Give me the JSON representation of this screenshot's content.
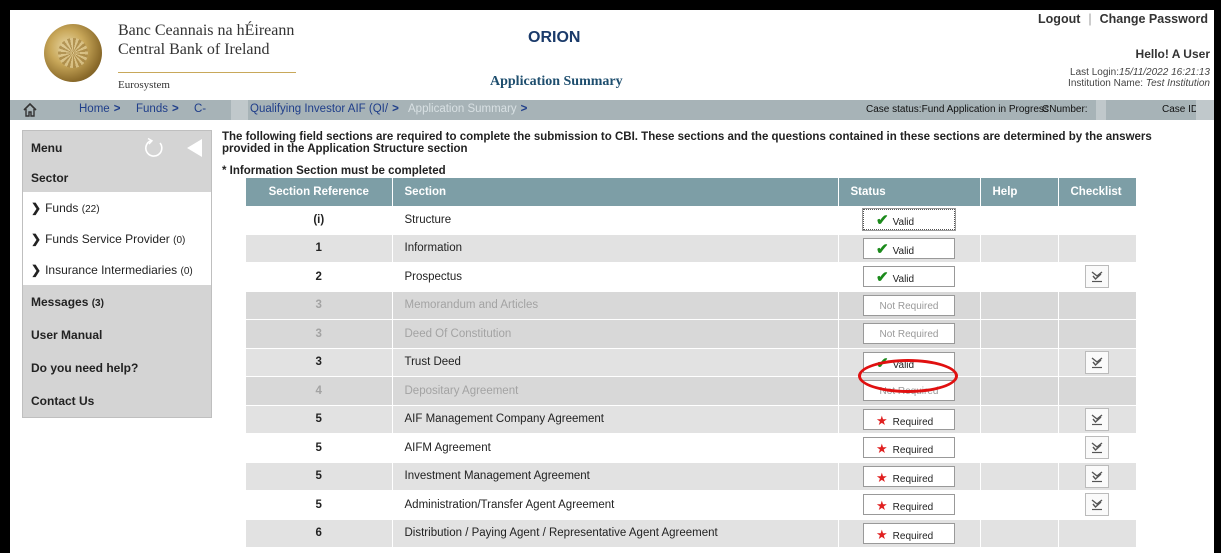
{
  "header": {
    "bank_irish": "Banc Ceannais na hÉireann",
    "bank_english": "Central Bank of Ireland",
    "eurosystem": "Eurosystem",
    "app_name": "ORION",
    "page_heading": "Application Summary",
    "logout": "Logout",
    "separator": "|",
    "change_password": "Change Password",
    "greeting": "Hello! A User",
    "last_login_label": "Last Login:",
    "last_login_value": "15/11/2022 16:21:13",
    "institution_label": "Institution Name:",
    "institution_value": "Test Institution"
  },
  "breadcrumb": {
    "home": "Home",
    "funds": "Funds",
    "c_fragment": "C-",
    "qualifying": "Qualifying Investor AIF (QI/",
    "current": "Application Summary",
    "case_status": "Case status:Fund Application in Progress",
    "cnumber": "CNumber:",
    "caseid": "Case ID:"
  },
  "sidebar": {
    "menu": "Menu",
    "sector": "Sector",
    "funds_label": "Funds",
    "funds_count": "(22)",
    "fsp_label": "Funds Service Provider",
    "fsp_count": "(0)",
    "ins_label": "Insurance Intermediaries",
    "ins_count": "(0)",
    "messages_label": "Messages",
    "messages_count": "(3)",
    "user_manual": "User Manual",
    "need_help": "Do you need help?",
    "contact_us": "Contact Us"
  },
  "intro": {
    "text": "The following field sections are required to complete the submission to CBI. These sections and the questions contained in these sections are determined by the answers provided in the Application Structure section",
    "note": "* Information Section must be completed"
  },
  "table": {
    "headers": {
      "ref": "Section Reference",
      "section": "Section",
      "status": "Status",
      "help": "Help",
      "checklist": "Checklist"
    },
    "rows": [
      {
        "ref": "(i)",
        "section": "Structure",
        "status": "Valid"
      },
      {
        "ref": "1",
        "section": "Information",
        "status": "Valid"
      },
      {
        "ref": "2",
        "section": "Prospectus",
        "status": "Valid"
      },
      {
        "ref": "3",
        "section": "Memorandum and Articles",
        "status": "Not Required"
      },
      {
        "ref": "3",
        "section": "Deed Of Constitution",
        "status": "Not Required"
      },
      {
        "ref": "3",
        "section": "Trust Deed",
        "status": "Valid"
      },
      {
        "ref": "4",
        "section": "Depositary Agreement",
        "status": "Not Required"
      },
      {
        "ref": "5",
        "section": "AIF Management Company Agreement",
        "status": "Required"
      },
      {
        "ref": "5",
        "section": "AIFM Agreement",
        "status": "Required"
      },
      {
        "ref": "5",
        "section": "Investment Management Agreement",
        "status": "Required"
      },
      {
        "ref": "5",
        "section": "Administration/Transfer Agent Agreement",
        "status": "Required"
      },
      {
        "ref": "6",
        "section": "Distribution / Paying Agent / Representative Agent Agreement",
        "status": "Required"
      }
    ]
  },
  "colors": {
    "table_header": "#7d9ea6",
    "crumb_bar": "#a7b3b7",
    "valid": "#1b8a1b",
    "required": "#e02020",
    "highlight": "#e01010"
  },
  "icons": [
    "home-icon",
    "refresh-icon",
    "collapse-icon",
    "check-icon",
    "star-icon",
    "checklist-icon"
  ]
}
